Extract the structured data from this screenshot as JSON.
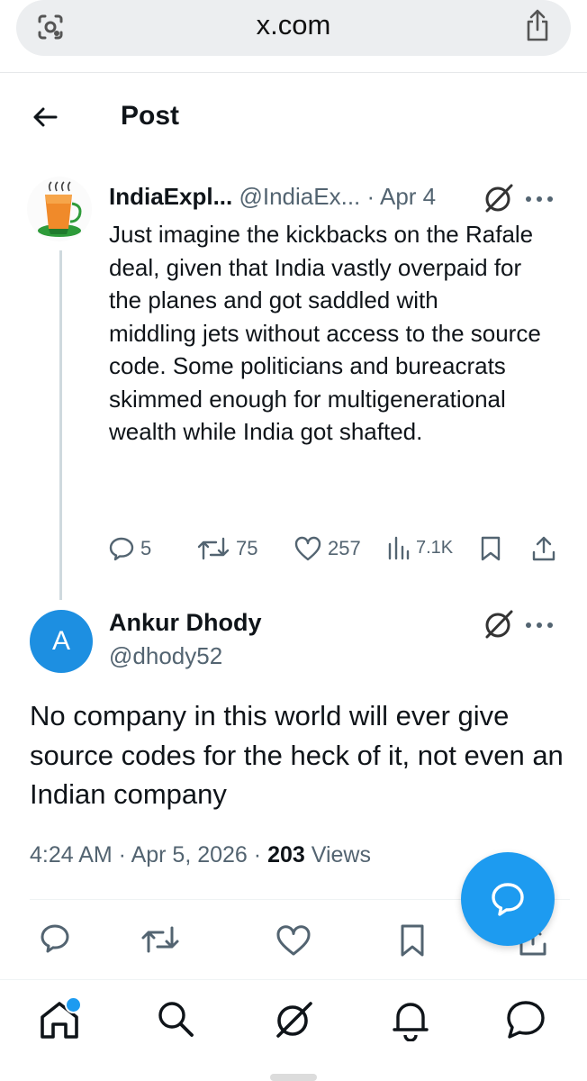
{
  "browser": {
    "url": "x.com",
    "lens_icon": "camera-lens-icon",
    "share_icon": "share-icon"
  },
  "header": {
    "title": "Post",
    "back_icon": "arrow-left-icon"
  },
  "original_tweet": {
    "display_name": "IndiaExpl...",
    "handle": "@IndiaEx...",
    "separator": "·",
    "date": "Apr 4",
    "text": "Just imagine the kickbacks on the Rafale deal, given that India vastly overpaid for the planes and got saddled with\nmiddling jets without access to the source code. Some politicians and bureacrats skimmed enough for multigenerational wealth while India got shafted.",
    "replies": "5",
    "reposts": "75",
    "likes": "257",
    "views": "7.1K"
  },
  "reply_tweet": {
    "avatar_letter": "A",
    "display_name": "Ankur Dhody",
    "handle": "@dhody52",
    "text": "No company in this world will ever give source codes for the heck of it, not even an Indian company",
    "time": "4:24 AM",
    "separator1": " · ",
    "date": "Apr 5, 2026",
    "separator2": " · ",
    "views_count": "203",
    "views_label": "Views"
  },
  "colors": {
    "accent": "#1d9bf0",
    "secondary_text": "#536471",
    "avatar_bg": "#1d8fe1"
  },
  "bottom_nav": [
    "home-icon",
    "search-icon",
    "grok-icon",
    "notifications-icon",
    "messages-icon"
  ]
}
